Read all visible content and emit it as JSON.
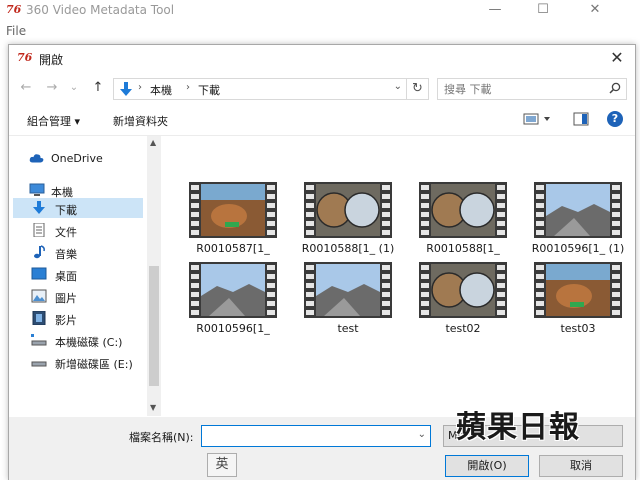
{
  "app": {
    "logo": "76",
    "title": "360 Video Metadata Tool",
    "menu": [
      "File"
    ],
    "minimize": "—",
    "maximize": "☐",
    "close": "✕"
  },
  "dialog": {
    "logo": "76",
    "title": "開啟",
    "close": "✕",
    "nav": {
      "back": "←",
      "forward": "→",
      "recent": "⌄",
      "up": "↑",
      "path": [
        "本機",
        "下載"
      ],
      "refresh": "↻",
      "search_placeholder": "搜尋 下載"
    },
    "toolbar": {
      "organize": "組合管理 ▾",
      "new_folder": "新增資料夾"
    },
    "sidebar": [
      {
        "label": "OneDrive",
        "icon": "cloud-icon"
      },
      {
        "label": "本機",
        "icon": "computer-icon"
      },
      {
        "label": "下載",
        "icon": "download-icon",
        "selected": true
      },
      {
        "label": "文件",
        "icon": "document-icon"
      },
      {
        "label": "音樂",
        "icon": "music-icon"
      },
      {
        "label": "桌面",
        "icon": "desktop-icon"
      },
      {
        "label": "圖片",
        "icon": "pictures-icon"
      },
      {
        "label": "影片",
        "icon": "videos-icon"
      },
      {
        "label": "本機磁碟 (C:)",
        "icon": "drive-icon"
      },
      {
        "label": "新增磁碟區 (E:)",
        "icon": "drive-icon"
      }
    ],
    "files": [
      {
        "name": "R0010587[1_",
        "style": "warm"
      },
      {
        "name": "R0010588[1_ (1)",
        "style": "dual"
      },
      {
        "name": "R0010588[1_",
        "style": "dual"
      },
      {
        "name": "R0010596[1_ (1)",
        "style": "sky"
      },
      {
        "name": "R0010596[1_",
        "style": "sky"
      },
      {
        "name": "test",
        "style": "sky"
      },
      {
        "name": "test02",
        "style": "dual"
      },
      {
        "name": "test03",
        "style": "warm"
      }
    ],
    "bottom": {
      "filename_label": "檔案名稱(N):",
      "filename_value": "",
      "filter": "Mp",
      "ime": "英",
      "open": "開啟(O)",
      "cancel": "取消"
    }
  },
  "watermark": "蘋果日報",
  "colors": {
    "accent": "#0078d7",
    "selection": "#cce4f7",
    "logo": "#c0281c",
    "help": "#1e63b8"
  }
}
